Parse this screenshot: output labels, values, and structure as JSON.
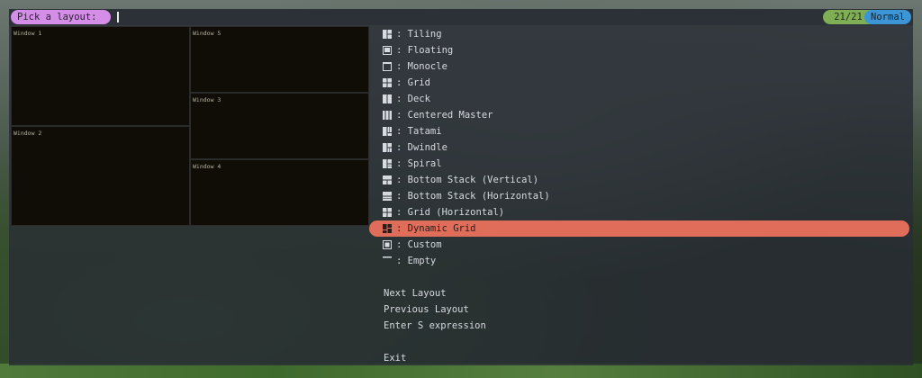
{
  "prompt": {
    "label": "Pick a layout:"
  },
  "status": {
    "counter": "21/21",
    "mode": "Normal"
  },
  "preview": {
    "windows": [
      {
        "label": "Window 1"
      },
      {
        "label": "Window 2"
      },
      {
        "label": "Window 5"
      },
      {
        "label": "Window 3"
      },
      {
        "label": "Window 4"
      }
    ]
  },
  "layouts": [
    {
      "label": ": Tiling",
      "icon": "tiling-icon"
    },
    {
      "label": ": Floating",
      "icon": "floating-icon"
    },
    {
      "label": ": Monocle",
      "icon": "monocle-icon"
    },
    {
      "label": ": Grid",
      "icon": "grid-icon"
    },
    {
      "label": ": Deck",
      "icon": "deck-icon"
    },
    {
      "label": ": Centered Master",
      "icon": "centered-master-icon"
    },
    {
      "label": ": Tatami",
      "icon": "tatami-icon"
    },
    {
      "label": ": Dwindle",
      "icon": "dwindle-icon"
    },
    {
      "label": ": Spiral",
      "icon": "spiral-icon"
    },
    {
      "label": ": Bottom Stack (Vertical)",
      "icon": "bottom-stack-vertical-icon"
    },
    {
      "label": ": Bottom Stack (Horizontal)",
      "icon": "bottom-stack-horizontal-icon"
    },
    {
      "label": ": Grid (Horizontal)",
      "icon": "grid-horizontal-icon"
    },
    {
      "label": ": Dynamic Grid",
      "icon": "dynamic-grid-icon",
      "selected": true
    },
    {
      "label": ": Custom",
      "icon": "custom-icon"
    },
    {
      "label": ": Empty",
      "icon": "empty-icon"
    }
  ],
  "actions": [
    {
      "label": "Next Layout"
    },
    {
      "label": "Previous Layout"
    },
    {
      "label": "Enter S expression"
    },
    {
      "label": "Exit"
    }
  ],
  "colors": {
    "prompt": "#d48ee8",
    "counter": "#7fae55",
    "mode": "#3c95d4",
    "selection": "#e06c5a"
  }
}
